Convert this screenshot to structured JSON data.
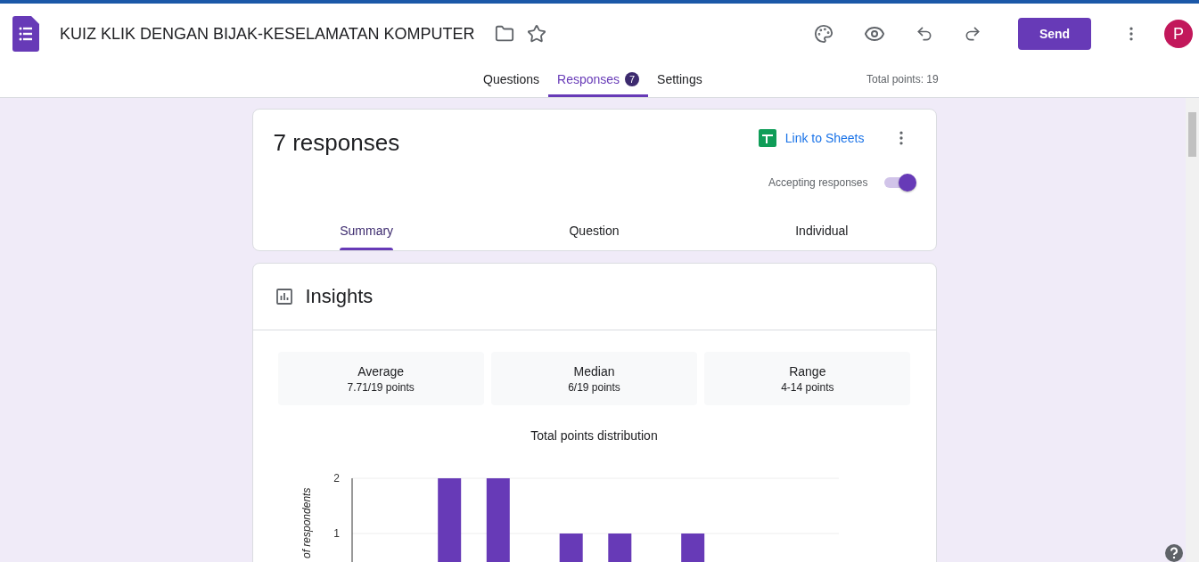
{
  "header": {
    "title": "KUIZ KLIK DENGAN BIJAK-KESELAMATAN KOMPUTER",
    "send_label": "Send",
    "avatar_letter": "P"
  },
  "tabs": [
    {
      "label": "Questions",
      "selected": false
    },
    {
      "label": "Responses",
      "selected": true,
      "badge": "7"
    },
    {
      "label": "Settings",
      "selected": false
    }
  ],
  "total_points": "Total points: 19",
  "responses_card": {
    "title": "7 responses",
    "link_label": "Link to Sheets",
    "accepting_label": "Accepting responses",
    "accepting": true,
    "subtabs": [
      {
        "label": "Summary",
        "selected": true
      },
      {
        "label": "Question",
        "selected": false
      },
      {
        "label": "Individual",
        "selected": false
      }
    ]
  },
  "insights": {
    "title": "Insights",
    "stats": [
      {
        "label": "Average",
        "value": "7.71/19 points"
      },
      {
        "label": "Median",
        "value": "6/19 points"
      },
      {
        "label": "Range",
        "value": "4-14 points"
      }
    ],
    "chart_data": {
      "type": "bar",
      "title": "Total points distribution",
      "ylabel": "of respondents",
      "categories": [
        null,
        null,
        null,
        null,
        null,
        null,
        null,
        null,
        null,
        null,
        null,
        null,
        null,
        null,
        null,
        null,
        null,
        null,
        null,
        null,
        null
      ],
      "values": [
        0,
        0,
        0,
        0,
        2,
        0,
        2,
        0,
        0,
        1,
        0,
        1,
        0,
        0,
        1,
        0,
        0,
        0,
        0,
        0,
        0
      ],
      "ylim": [
        0,
        2
      ],
      "yticks": [
        1,
        2
      ]
    }
  }
}
